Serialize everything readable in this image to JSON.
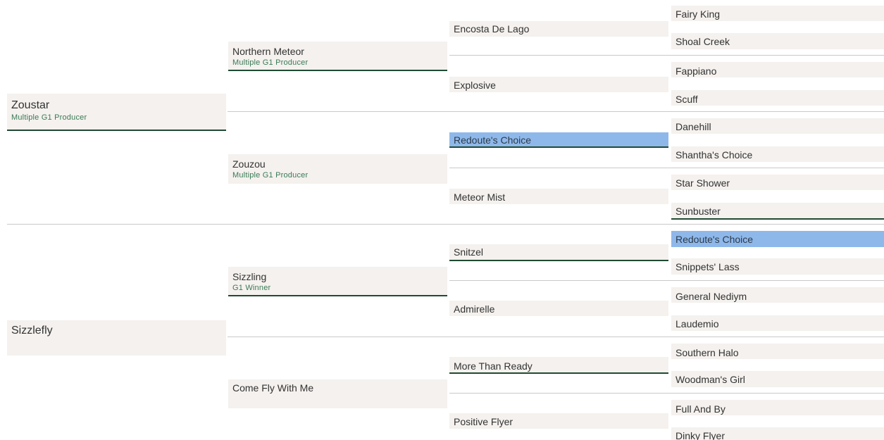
{
  "pedigree": {
    "sire": {
      "name": "Zoustar",
      "note": "Multiple G1 Producer"
    },
    "dam": {
      "name": "Sizzlefly",
      "note": ""
    },
    "gen2": [
      {
        "name": "Northern Meteor",
        "note": "Multiple G1 Producer"
      },
      {
        "name": "Zouzou",
        "note": "Multiple G1 Producer"
      },
      {
        "name": "Sizzling",
        "note": "G1 Winner"
      },
      {
        "name": "Come Fly With Me",
        "note": ""
      }
    ],
    "gen3": [
      {
        "name": "Encosta De Lago"
      },
      {
        "name": "Explosive"
      },
      {
        "name": "Redoute's Choice",
        "highlight": true
      },
      {
        "name": "Meteor Mist"
      },
      {
        "name": "Snitzel"
      },
      {
        "name": "Admirelle"
      },
      {
        "name": "More Than Ready"
      },
      {
        "name": "Positive Flyer"
      }
    ],
    "gen4": [
      {
        "name": "Fairy King"
      },
      {
        "name": "Shoal Creek"
      },
      {
        "name": "Fappiano"
      },
      {
        "name": "Scuff"
      },
      {
        "name": "Danehill"
      },
      {
        "name": "Shantha's Choice"
      },
      {
        "name": "Star Shower"
      },
      {
        "name": "Sunbuster"
      },
      {
        "name": "Redoute's Choice",
        "highlight": true
      },
      {
        "name": "Snippets' Lass"
      },
      {
        "name": "General Nediym"
      },
      {
        "name": "Laudemio"
      },
      {
        "name": "Southern Halo"
      },
      {
        "name": "Woodman's Girl"
      },
      {
        "name": "Full And By"
      },
      {
        "name": "Dinky Flyer"
      }
    ]
  }
}
